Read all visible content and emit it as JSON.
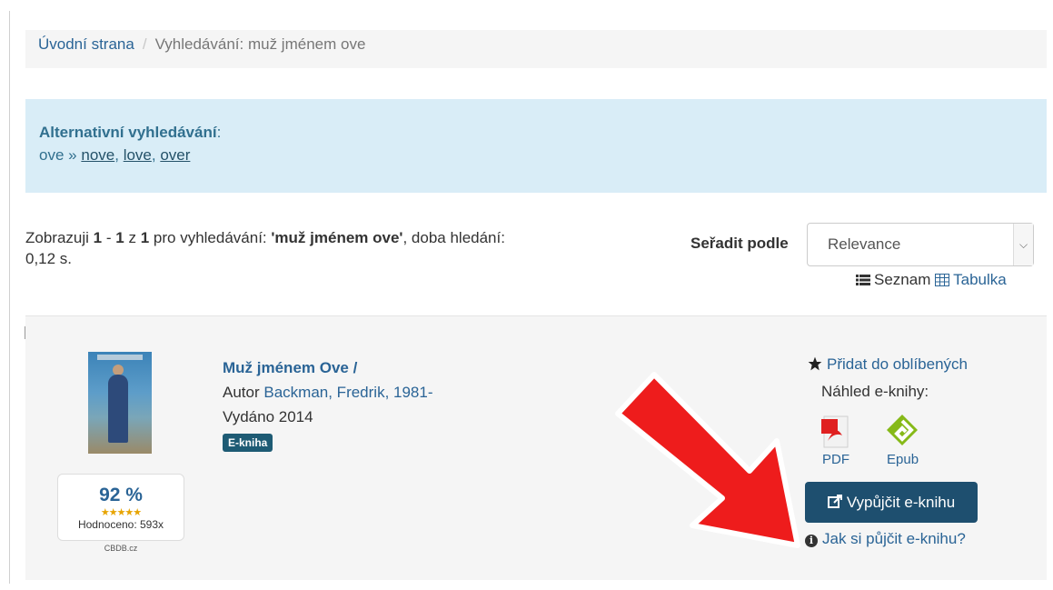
{
  "breadcrumb": {
    "home": "Úvodní strana",
    "separator": "/",
    "current": "Vyhledávání: muž jménem ove"
  },
  "alternative": {
    "title": "Alternativní vyhledávání",
    "title_suffix": ":",
    "query": "ove",
    "arrow": "»",
    "suggestions": [
      "nove",
      "love",
      "over"
    ]
  },
  "results": {
    "prefix": "Zobrazuji",
    "from": "1",
    "dash": "-",
    "to": "1",
    "of_word": "z",
    "total": "1",
    "for_search": "pro vyhledávání:",
    "query": "'muž jménem ove'",
    "time_label": ", doba hledání: 0,12 s."
  },
  "sort": {
    "label": "Seřadit podle",
    "selected": "Relevance"
  },
  "views": {
    "list": "Seznam",
    "table": "Tabulka"
  },
  "record": {
    "title": "Muž jménem Ove /",
    "author_label": "Autor",
    "author": "Backman, Fredrik, 1981-",
    "published": "Vydáno 2014",
    "format_badge": "E-kniha",
    "rating": {
      "percent": "92 %",
      "stars": "★★★★★",
      "rated": "Hodnoceno: 593x",
      "source": "CBDB.cz"
    },
    "actions": {
      "favorite": "Přidat do oblíbených",
      "preview_label": "Náhled e-knihy:",
      "formats": [
        "PDF",
        "Epub"
      ],
      "borrow": "Vypůjčit e-knihu",
      "howto": "Jak si půjčit e-knihu?"
    }
  },
  "colors": {
    "link": "#2a6496",
    "alert_bg": "#d9edf7",
    "button": "#1e4f6f",
    "badge": "#1e5b74",
    "arrow": "#ee1c1c"
  },
  "icons": {
    "favorite": "star-icon",
    "list_view": "list-icon",
    "table_view": "table-icon",
    "borrow": "external-link-icon",
    "help": "info-icon",
    "pdf": "pdf-file-icon",
    "epub": "epub-icon",
    "overlay": "red-arrow-annotation"
  }
}
